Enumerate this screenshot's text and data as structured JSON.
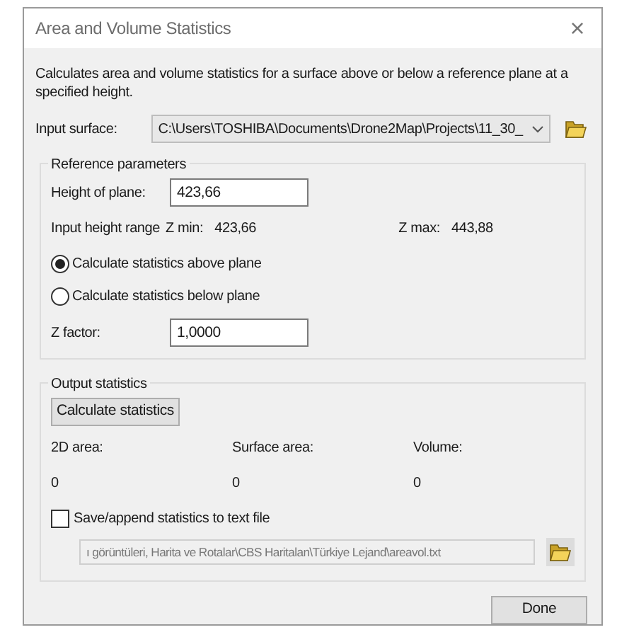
{
  "window": {
    "title": "Area and Volume Statistics",
    "close": "×"
  },
  "description": "Calculates area and volume statistics for a surface above or below a reference plane at a specified height.",
  "input_surface": {
    "label": "Input surface:",
    "value": "C:\\Users\\TOSHIBA\\Documents\\Drone2Map\\Projects\\11_30_"
  },
  "reference": {
    "title": "Reference parameters",
    "height_label": "Height of plane:",
    "height_value": "423,66",
    "range_label": "Input height range",
    "zmin_label": "Z min:",
    "zmin": "423,66",
    "zmax_label": "Z max:",
    "zmax": "443,88",
    "options": [
      {
        "label": "Calculate statistics above plane",
        "selected": true
      },
      {
        "label": "Calculate statistics below plane",
        "selected": false
      }
    ],
    "zfactor_label": "Z factor:",
    "zfactor_value": "1,0000"
  },
  "output": {
    "title": "Output statistics",
    "button": "Calculate statistics",
    "columns": [
      {
        "label": "2D area:",
        "value": "0"
      },
      {
        "label": "Surface area:",
        "value": "0"
      },
      {
        "label": "Volume:",
        "value": "0"
      }
    ],
    "save": {
      "label": "Save/append statistics to text file",
      "checked": false
    },
    "path": {
      "value": "ı görüntüleri, Harita ve Rotalar\\CBS Haritalan\\Türkiye Lejand\\areavol.txt",
      "disabled": true
    }
  },
  "buttons": [
    "Done"
  ]
}
